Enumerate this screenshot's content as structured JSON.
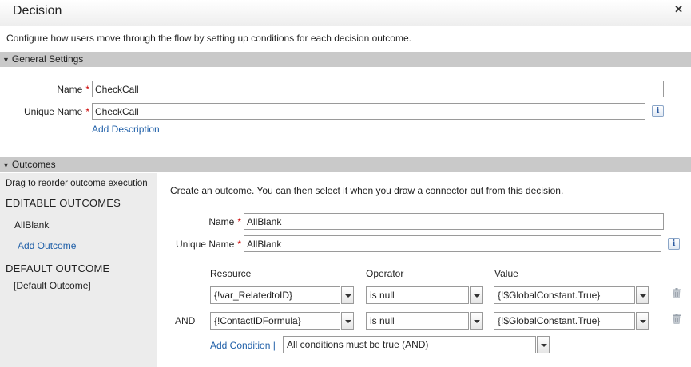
{
  "window": {
    "title": "Decision"
  },
  "intro_text": "Configure how users move through the flow by setting up conditions for each decision outcome.",
  "general_settings": {
    "heading": "General Settings",
    "name_label": "Name",
    "name_value": "CheckCall",
    "unique_name_label": "Unique Name",
    "unique_name_value": "CheckCall",
    "add_description": "Add Description"
  },
  "outcomes": {
    "heading": "Outcomes",
    "sidebar": {
      "hint": "Drag to reorder outcome execution",
      "editable_heading": "EDITABLE OUTCOMES",
      "editable_items": [
        "AllBlank"
      ],
      "add_outcome": "Add Outcome",
      "default_heading": "DEFAULT OUTCOME",
      "default_item": "[Default Outcome]"
    },
    "panel": {
      "intro": "Create an outcome.  You can then select it when you draw a connector out from this decision.",
      "name_label": "Name",
      "name_value": "AllBlank",
      "unique_name_label": "Unique Name",
      "unique_name_value": "AllBlank",
      "columns": {
        "resource": "Resource",
        "operator": "Operator",
        "value": "Value"
      },
      "conditions": [
        {
          "prefix": "",
          "resource": "{!var_RelatedtoID}",
          "operator": "is null",
          "value": "{!$GlobalConstant.True}"
        },
        {
          "prefix": "AND",
          "resource": "{!ContactIDFormula}",
          "operator": "is null",
          "value": "{!$GlobalConstant.True}"
        }
      ],
      "add_condition": "Add Condition |",
      "logic_selected": "All conditions must be true (AND)"
    }
  },
  "colors": {
    "link": "#1f5fa8",
    "required": "#cc0000",
    "section_bg": "#c9c9c9",
    "sidebar_bg": "#ececec"
  }
}
